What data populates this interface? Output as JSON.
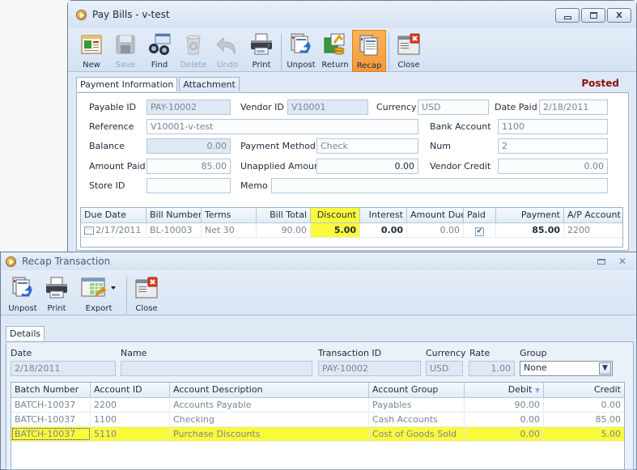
{
  "pay_bills": {
    "title": "Pay Bills - v-test",
    "window_controls": {
      "minimize": "▭",
      "restore": "▣",
      "close": "X"
    },
    "toolbar": [
      {
        "label": "New",
        "icon": "new-document-icon",
        "state": "enabled"
      },
      {
        "label": "Save",
        "icon": "floppy-disk-icon",
        "state": "disabled"
      },
      {
        "label": "Find",
        "icon": "binoculars-icon",
        "state": "enabled"
      },
      {
        "label": "Delete",
        "icon": "recycle-bin-icon",
        "state": "disabled"
      },
      {
        "label": "Undo",
        "icon": "undo-arrow-icon",
        "state": "disabled"
      },
      {
        "label": "Print",
        "icon": "printer-icon",
        "state": "enabled"
      },
      {
        "label": "Unpost",
        "icon": "unpost-icon",
        "state": "enabled"
      },
      {
        "label": "Return",
        "icon": "return-money-icon",
        "state": "enabled"
      },
      {
        "label": "Recap",
        "icon": "recap-icon",
        "state": "active"
      },
      {
        "label": "Close",
        "icon": "close-window-icon",
        "state": "enabled"
      }
    ],
    "tabs": [
      "Payment Information",
      "Attachment"
    ],
    "status": "Posted",
    "form": {
      "payable_id": {
        "label": "Payable ID",
        "value": "PAY-10002"
      },
      "vendor_id": {
        "label": "Vendor ID",
        "value": "V10001"
      },
      "currency": {
        "label": "Currency",
        "value": "USD"
      },
      "date_paid": {
        "label": "Date Paid",
        "value": "2/18/2011"
      },
      "reference": {
        "label": "Reference",
        "value": "V10001-v-test"
      },
      "bank_account": {
        "label": "Bank Account",
        "value": "1100"
      },
      "balance": {
        "label": "Balance",
        "value": "0.00"
      },
      "payment_method": {
        "label": "Payment Method",
        "value": "Check"
      },
      "num": {
        "label": "Num",
        "value": "2"
      },
      "amount_paid": {
        "label": "Amount Paid",
        "value": "85.00"
      },
      "unapplied_amount": {
        "label": "Unapplied Amount",
        "value": "0.00"
      },
      "vendor_credit": {
        "label": "Vendor Credit",
        "value": "0.00"
      },
      "store_id": {
        "label": "Store ID",
        "value": ""
      },
      "memo": {
        "label": "Memo",
        "value": ""
      }
    },
    "grid": {
      "columns": [
        "Due Date",
        "Bill Number",
        "Terms",
        "Bill Total",
        "Discount",
        "Interest",
        "Amount Due",
        "Paid",
        "Payment",
        "A/P Account"
      ],
      "rows": [
        {
          "due_date": "2/17/2011",
          "bill_number": "BL-10003",
          "terms": "Net 30",
          "bill_total": "90.00",
          "discount": "5.00",
          "interest": "0.00",
          "amount_due": "0.00",
          "paid": true,
          "payment": "85.00",
          "ap_account": "2200"
        }
      ]
    }
  },
  "recap": {
    "title": "Recap Transaction",
    "window_controls": {
      "restore": "▭",
      "close": "✕"
    },
    "toolbar": [
      {
        "label": "Unpost",
        "icon": "unpost-icon"
      },
      {
        "label": "Print",
        "icon": "printer-icon"
      },
      {
        "label": "Export",
        "icon": "export-spreadsheet-icon"
      },
      {
        "label": "Close",
        "icon": "close-window-icon"
      }
    ],
    "tabs": [
      "Details"
    ],
    "form": {
      "date": {
        "label": "Date",
        "value": "2/18/2011"
      },
      "name": {
        "label": "Name",
        "value": ""
      },
      "transaction_id": {
        "label": "Transaction ID",
        "value": "PAY-10002"
      },
      "currency": {
        "label": "Currency",
        "value": "USD"
      },
      "rate": {
        "label": "Rate",
        "value": "1.00"
      },
      "group": {
        "label": "Group",
        "value": "None"
      }
    },
    "grid": {
      "columns": [
        "Batch Number",
        "Account ID",
        "Account Description",
        "Account Group",
        "Debit",
        "Credit"
      ],
      "rows": [
        {
          "batch": "BATCH-10037",
          "account_id": "2200",
          "description": "Accounts Payable",
          "group": "Payables",
          "debit": "90.00",
          "credit": "0.00"
        },
        {
          "batch": "BATCH-10037",
          "account_id": "1100",
          "description": "Checking",
          "group": "Cash Accounts",
          "debit": "0.00",
          "credit": "85.00"
        },
        {
          "batch": "BATCH-10037",
          "account_id": "5110",
          "description": "Purchase Discounts",
          "group": "Cost of Goods Sold",
          "debit": "0.00",
          "credit": "5.00"
        }
      ]
    }
  }
}
